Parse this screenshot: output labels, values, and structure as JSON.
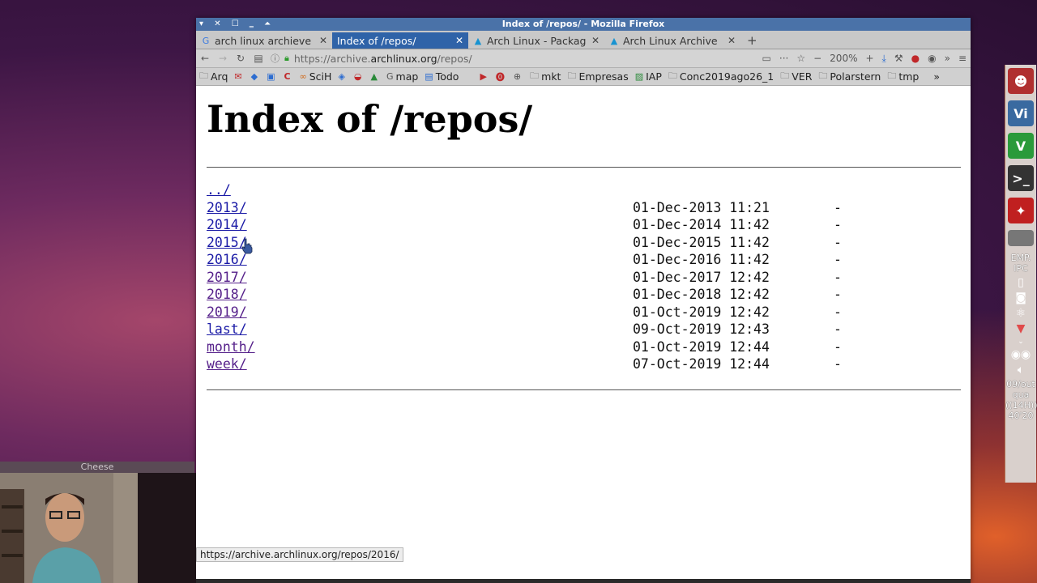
{
  "window": {
    "title": "Index of /repos/ - Mozilla Firefox"
  },
  "tabs": [
    {
      "label": "arch linux archieve",
      "favicon": "google-icon",
      "active": false
    },
    {
      "label": "Index of /repos/",
      "favicon": "",
      "active": true
    },
    {
      "label": "Arch Linux - Packag",
      "favicon": "arch-icon",
      "active": false
    },
    {
      "label": "Arch Linux Archive",
      "favicon": "arch-icon",
      "active": false
    }
  ],
  "navbar": {
    "url_prefix": "https://archive.",
    "url_domain": "archlinux.org",
    "url_path": "/repos/",
    "zoom": "200%"
  },
  "bookmarks": [
    {
      "label": "Arq",
      "icon": "folder-icon"
    },
    {
      "label": "",
      "icon": "gmail-icon"
    },
    {
      "label": "",
      "icon": "python-icon"
    },
    {
      "label": "",
      "icon": "box-icon"
    },
    {
      "label": "",
      "icon": "c-icon"
    },
    {
      "label": "SciH",
      "icon": "scih-icon"
    },
    {
      "label": "",
      "icon": "bird-icon"
    },
    {
      "label": "",
      "icon": "map-pin-icon"
    },
    {
      "label": "",
      "icon": "drive-icon"
    },
    {
      "label": "map",
      "icon": "google-icon"
    },
    {
      "label": "Todo",
      "icon": "doc-icon"
    },
    {
      "label": "",
      "icon": "youtube-icon"
    },
    {
      "label": "",
      "icon": "pinterest-icon"
    },
    {
      "label": "",
      "icon": "globe-icon"
    },
    {
      "label": "mkt",
      "icon": "folder-icon"
    },
    {
      "label": "Empresas",
      "icon": "folder-icon"
    },
    {
      "label": "IAP",
      "icon": "image-icon"
    },
    {
      "label": "Conc2019ago26_1",
      "icon": "folder-icon"
    },
    {
      "label": "VER",
      "icon": "folder-icon"
    },
    {
      "label": "Polarstern",
      "icon": "folder-icon"
    },
    {
      "label": "tmp",
      "icon": "folder-icon"
    }
  ],
  "page": {
    "heading": "Index of /repos/",
    "entries": [
      {
        "name": "../",
        "date": "",
        "size": ""
      },
      {
        "name": "2013/",
        "date": "01-Dec-2013 11:21",
        "size": "-"
      },
      {
        "name": "2014/",
        "date": "01-Dec-2014 11:42",
        "size": "-"
      },
      {
        "name": "2015/",
        "date": "01-Dec-2015 11:42",
        "size": "-"
      },
      {
        "name": "2016/",
        "date": "01-Dec-2016 11:42",
        "size": "-"
      },
      {
        "name": "2017/",
        "date": "01-Dec-2017 12:42",
        "size": "-"
      },
      {
        "name": "2018/",
        "date": "01-Dec-2018 12:42",
        "size": "-"
      },
      {
        "name": "2019/",
        "date": "01-Oct-2019 12:42",
        "size": "-"
      },
      {
        "name": "last/",
        "date": "09-Oct-2019 12:43",
        "size": "-"
      },
      {
        "name": "month/",
        "date": "01-Oct-2019 12:44",
        "size": "-"
      },
      {
        "name": "week/",
        "date": "07-Oct-2019 12:44",
        "size": "-"
      }
    ]
  },
  "status_url": "https://archive.archlinux.org/repos/2016/",
  "dock": {
    "label1": "EMP.",
    "label2": "IPC",
    "clock": [
      "09/out",
      "qua",
      "((14H))",
      "40'20"
    ]
  },
  "cheese": {
    "title": "Cheese"
  }
}
